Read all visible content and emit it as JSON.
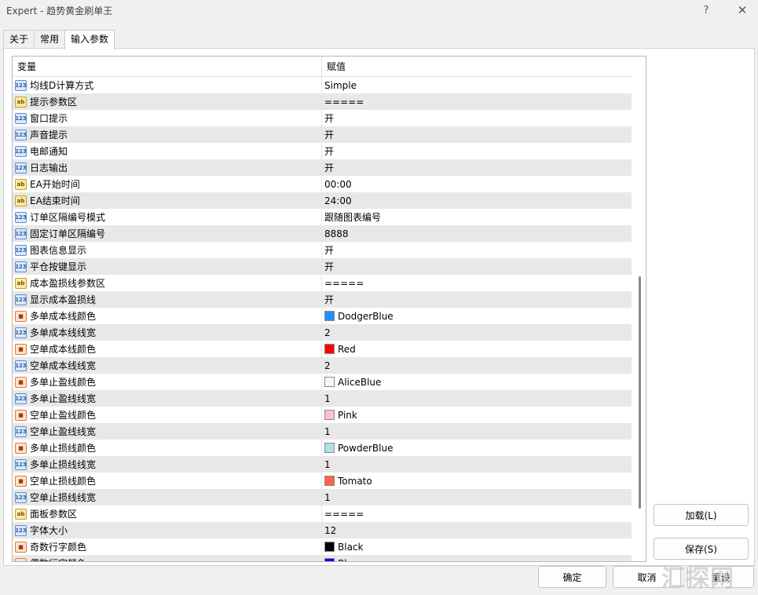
{
  "window": {
    "title": "Expert - 趋势黄金刷单王",
    "help_label": "?",
    "close_label": "✕"
  },
  "tabs": [
    {
      "label": "关于",
      "active": false
    },
    {
      "label": "常用",
      "active": false
    },
    {
      "label": "输入参数",
      "active": true
    }
  ],
  "grid": {
    "header": {
      "name": "变量",
      "value": "赋值"
    },
    "rows": [
      {
        "icon": "num",
        "name": "均线D计算方式",
        "value": "Simple"
      },
      {
        "icon": "str",
        "name": "提示参数区",
        "value": "====="
      },
      {
        "icon": "num",
        "name": "窗口提示",
        "value": "开"
      },
      {
        "icon": "num",
        "name": "声音提示",
        "value": "开"
      },
      {
        "icon": "num",
        "name": "电邮通知",
        "value": "开"
      },
      {
        "icon": "num",
        "name": "日志输出",
        "value": "开"
      },
      {
        "icon": "str",
        "name": "EA开始时间",
        "value": "00:00"
      },
      {
        "icon": "str",
        "name": "EA结束时间",
        "value": "24:00"
      },
      {
        "icon": "num",
        "name": "订单区隔编号模式",
        "value": "跟随图表编号"
      },
      {
        "icon": "num",
        "name": "固定订单区隔编号",
        "value": "8888"
      },
      {
        "icon": "num",
        "name": "图表信息显示",
        "value": "开"
      },
      {
        "icon": "num",
        "name": "平仓按键显示",
        "value": "开"
      },
      {
        "icon": "str",
        "name": "成本盈损线参数区",
        "value": "====="
      },
      {
        "icon": "num",
        "name": "显示成本盈损线",
        "value": "开"
      },
      {
        "icon": "col",
        "name": "多单成本线颜色",
        "value": "DodgerBlue",
        "color": "#1e90ff"
      },
      {
        "icon": "num",
        "name": "多单成本线线宽",
        "value": "2"
      },
      {
        "icon": "col",
        "name": "空单成本线颜色",
        "value": "Red",
        "color": "#ff0000"
      },
      {
        "icon": "num",
        "name": "空单成本线线宽",
        "value": "2"
      },
      {
        "icon": "col",
        "name": "多单止盈线颜色",
        "value": "AliceBlue",
        "color": "#f0f8ff"
      },
      {
        "icon": "num",
        "name": "多单止盈线线宽",
        "value": "1"
      },
      {
        "icon": "col",
        "name": "空单止盈线颜色",
        "value": "Pink",
        "color": "#ffc0cb"
      },
      {
        "icon": "num",
        "name": "空单止盈线线宽",
        "value": "1"
      },
      {
        "icon": "col",
        "name": "多单止损线颜色",
        "value": "PowderBlue",
        "color": "#b0e0e6"
      },
      {
        "icon": "num",
        "name": "多单止损线线宽",
        "value": "1"
      },
      {
        "icon": "col",
        "name": "空单止损线颜色",
        "value": "Tomato",
        "color": "#ff6347"
      },
      {
        "icon": "num",
        "name": "空单止损线线宽",
        "value": "1"
      },
      {
        "icon": "str",
        "name": "面板参数区",
        "value": "====="
      },
      {
        "icon": "num",
        "name": "字体大小",
        "value": "12"
      },
      {
        "icon": "col",
        "name": "奇数行字颜色",
        "value": "Black",
        "color": "#000000"
      },
      {
        "icon": "col",
        "name": "偶数行字颜色",
        "value": "Blue",
        "color": "#0000ff"
      }
    ]
  },
  "buttons": {
    "load": "加载(L)",
    "save": "保存(S)",
    "ok": "确定",
    "cancel": "取消",
    "reset": "重设"
  },
  "watermark": "汇探网"
}
